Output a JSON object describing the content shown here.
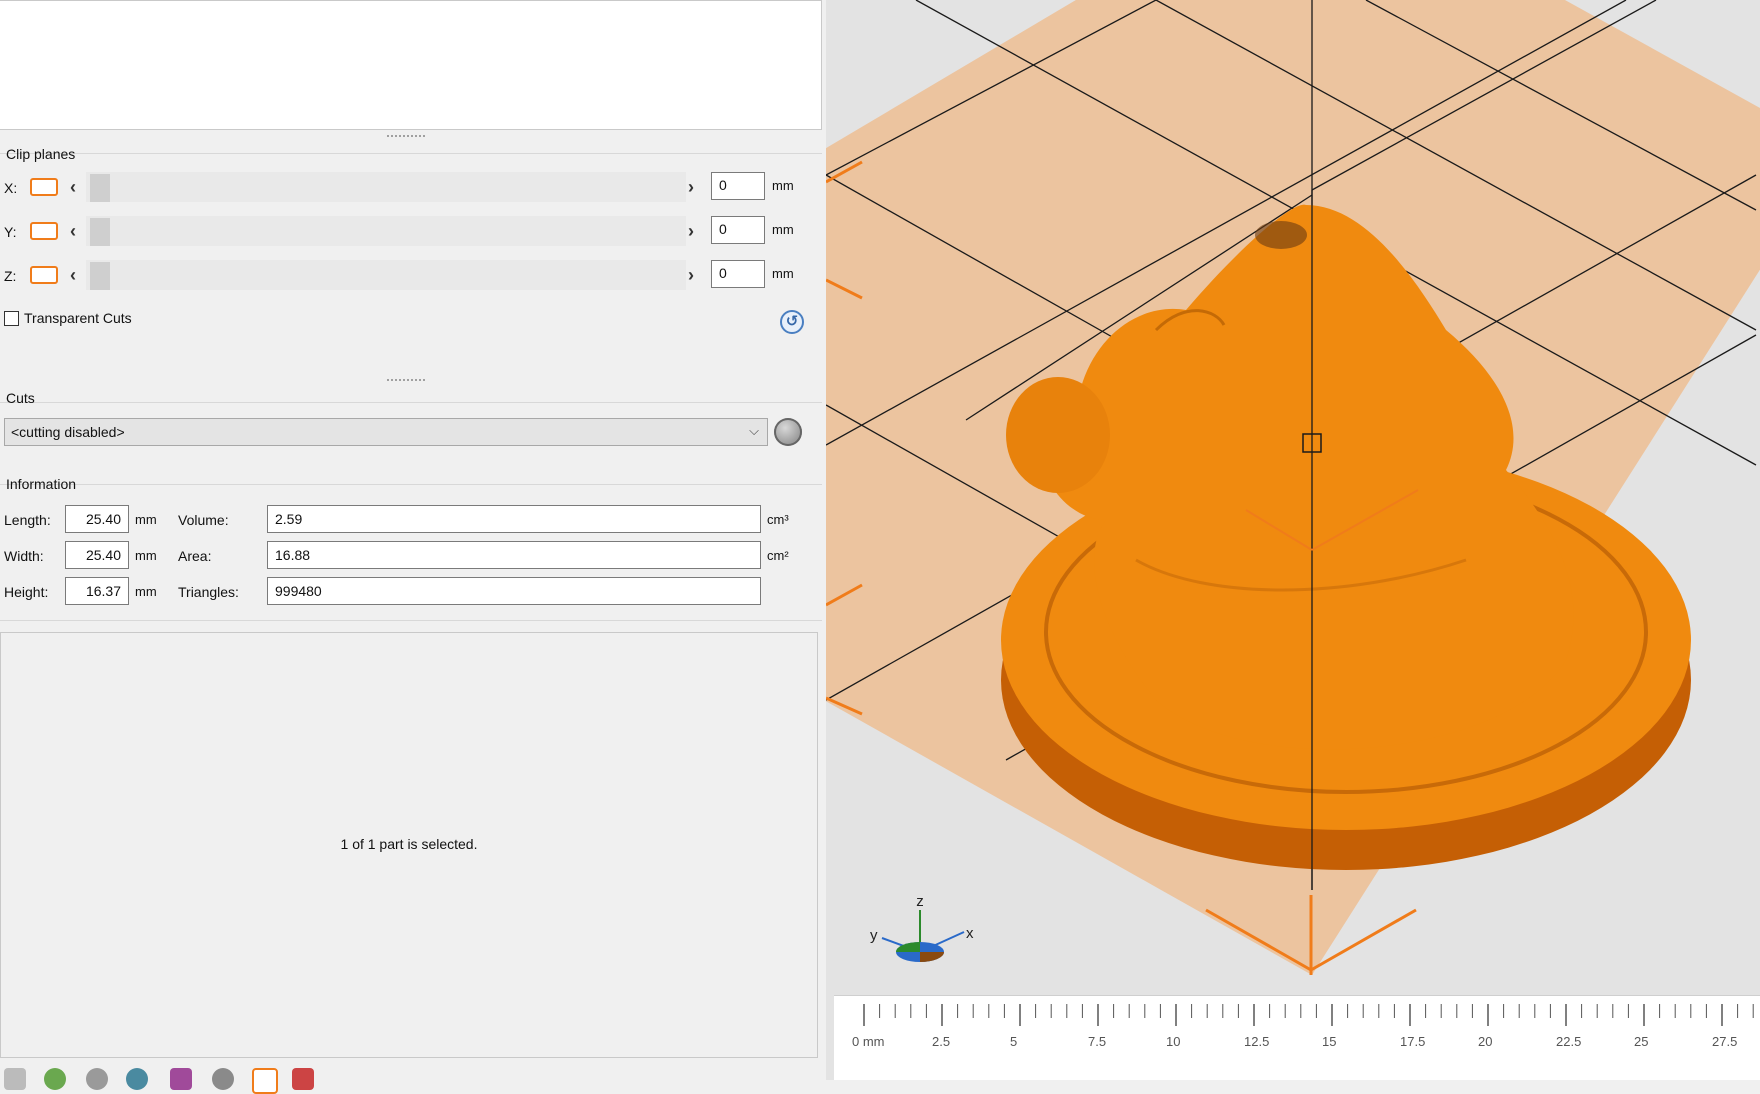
{
  "clip_planes": {
    "title": "Clip planes",
    "rows": [
      {
        "axis": "X:",
        "value": "0",
        "unit": "mm"
      },
      {
        "axis": "Y:",
        "value": "0",
        "unit": "mm"
      },
      {
        "axis": "Z:",
        "value": "0",
        "unit": "mm"
      }
    ],
    "transparent_cuts_label": "Transparent Cuts",
    "transparent_cuts_checked": false
  },
  "cuts": {
    "title": "Cuts",
    "selected": "<cutting disabled>"
  },
  "information": {
    "title": "Information",
    "length_label": "Length:",
    "length_value": "25.40",
    "length_unit": "mm",
    "width_label": "Width:",
    "width_value": "25.40",
    "width_unit": "mm",
    "height_label": "Height:",
    "height_value": "16.37",
    "height_unit": "mm",
    "volume_label": "Volume:",
    "volume_value": "2.59",
    "volume_unit": "cm³",
    "area_label": "Area:",
    "area_value": "16.88",
    "area_unit": "cm²",
    "triangles_label": "Triangles:",
    "triangles_value": "999480"
  },
  "status": {
    "selection_text": "1 of 1 part is selected."
  },
  "viewport": {
    "axis_labels": {
      "z": "z",
      "y": "y",
      "x": "x"
    },
    "model_color": "#f08a0f",
    "bed_color": "#ecc49f",
    "ruler_labels": [
      "0 mm",
      "2.5",
      "5",
      "7.5",
      "10",
      "12.5",
      "15",
      "17.5",
      "20",
      "22.5",
      "25",
      "27.5"
    ]
  }
}
